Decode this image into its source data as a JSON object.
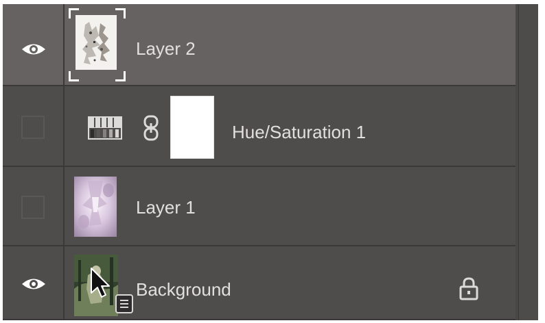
{
  "layers_panel": {
    "layers": [
      {
        "name": "Layer 2",
        "visible": true,
        "selected": true,
        "thumbnail": "torn-paper-texture"
      },
      {
        "name": "Hue/Saturation 1",
        "visible": false,
        "adjustment_icon": "hue-saturation-icon",
        "link_icon": "chain-link-icon",
        "mask": "white-layer-mask"
      },
      {
        "name": "Layer 1",
        "visible": false,
        "thumbnail": "pastel-abstract-texture"
      },
      {
        "name": "Background",
        "visible": true,
        "locked": true,
        "lock_icon": "lock-icon",
        "smart_badge": "document-badge-icon",
        "thumbnail": "green-forest-figure"
      }
    ]
  },
  "colors": {
    "panel_bg": "#4a4747",
    "row_bg": "#4f4c4c",
    "selected_row_bg": "#676262",
    "divider": "#3a3838",
    "text": "#e2dfdf"
  }
}
